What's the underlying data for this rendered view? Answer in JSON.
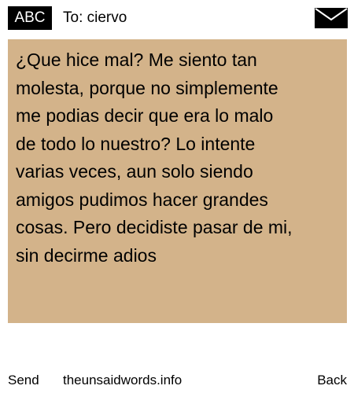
{
  "header": {
    "badge_label": "ABC",
    "to_label": "To: ciervo",
    "mail_icon": "envelope-icon"
  },
  "message": {
    "text": "¿Que hice mal? Me siento tan\nmolesta, porque no simplemente\nme podias decir que era lo malo\nde todo lo nuestro? Lo intente\nvarias veces, aun solo siendo\namigos pudimos hacer grandes\ncosas. Pero decidiste pasar de mi,\nsin decirme adios",
    "background_color": "#d3b38a"
  },
  "footer": {
    "send_label": "Send",
    "site_label": "theunsaidwords.info",
    "back_label": "Back"
  }
}
